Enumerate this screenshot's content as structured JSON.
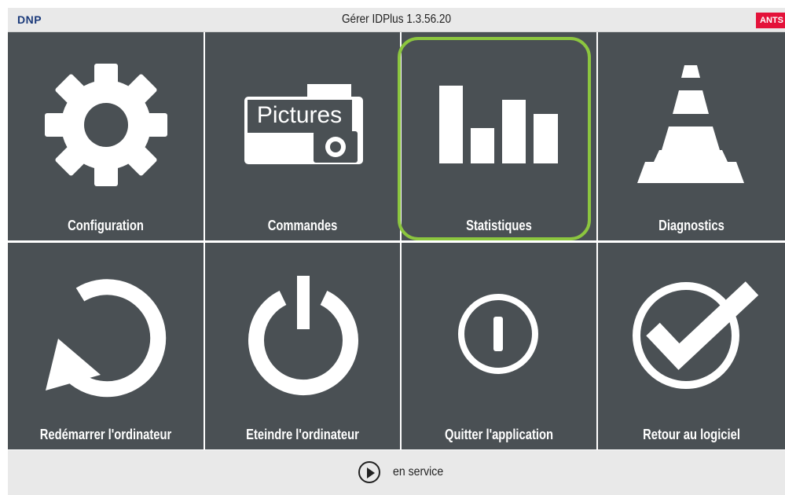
{
  "header": {
    "brand": "DNP",
    "title": "Gérer IDPlus 1.3.56.20",
    "badge": "ANTS"
  },
  "tiles": [
    {
      "label": "Configuration",
      "icon": "gear-icon"
    },
    {
      "label": "Commandes",
      "icon": "pictures-camera-icon",
      "icon_text": "Pictures"
    },
    {
      "label": "Statistiques",
      "icon": "bar-chart-icon",
      "highlighted": true
    },
    {
      "label": "Diagnostics",
      "icon": "traffic-cone-icon"
    },
    {
      "label": "Redémarrer l'ordinateur",
      "icon": "restart-icon"
    },
    {
      "label": "Eteindre l'ordinateur",
      "icon": "power-icon"
    },
    {
      "label": "Quitter l'application",
      "icon": "exit-icon"
    },
    {
      "label": "Retour au logiciel",
      "icon": "checkmark-icon"
    }
  ],
  "status": {
    "icon": "play-icon",
    "text": "en service"
  },
  "colors": {
    "tile": "#4a5054",
    "highlight": "#8cc63f",
    "badge": "#e4123a",
    "brand": "#1b3a7a"
  }
}
